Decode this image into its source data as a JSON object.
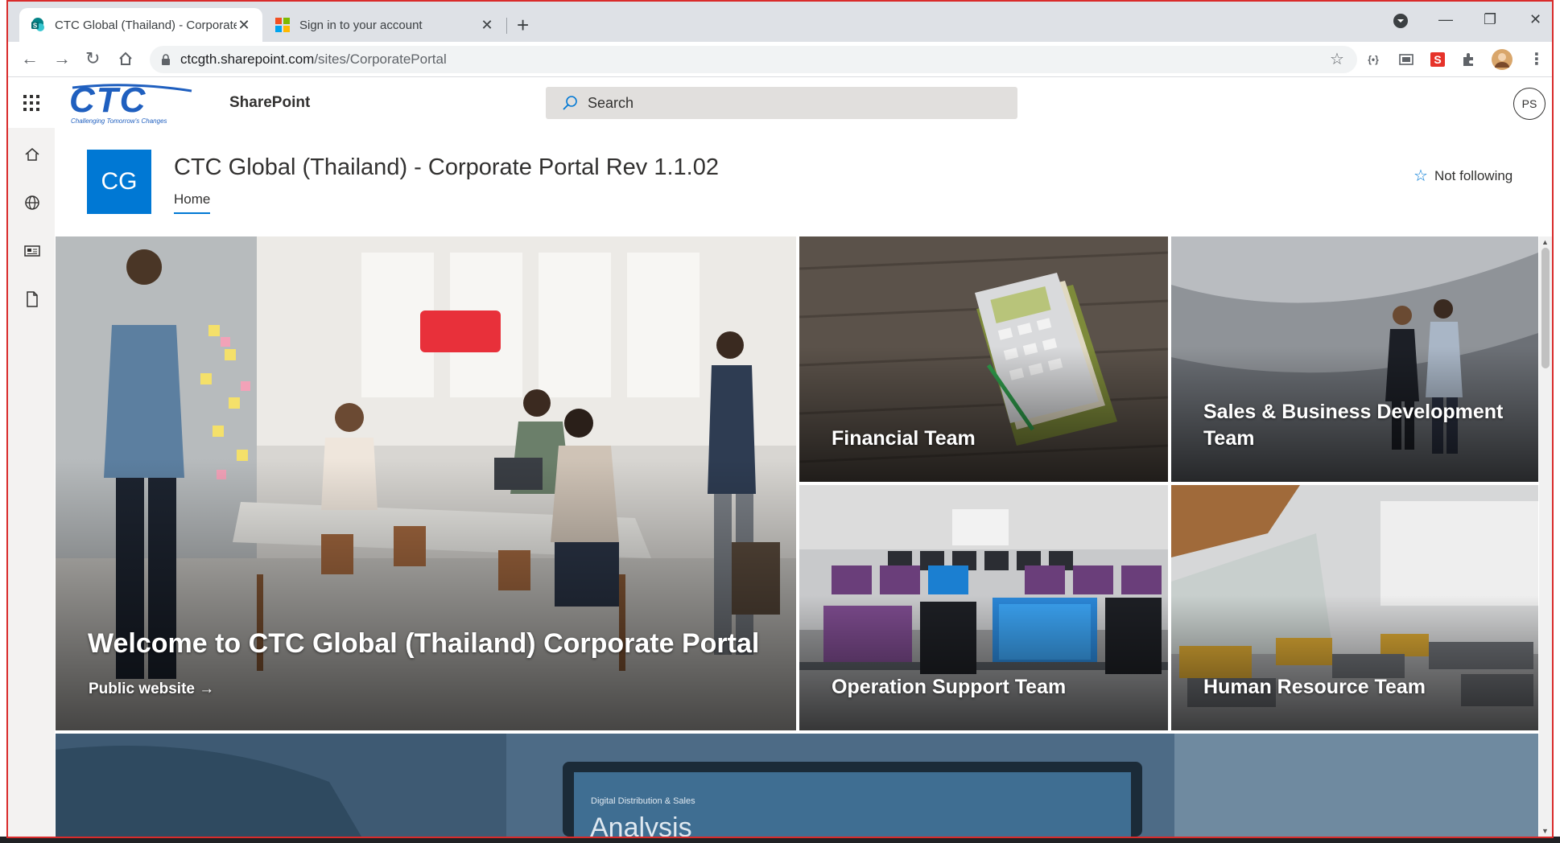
{
  "browser": {
    "tabs": [
      {
        "title": "CTC Global (Thailand) - Corporate Portal",
        "active": true
      },
      {
        "title": "Sign in to your account",
        "active": false
      }
    ],
    "new_tab": "+",
    "close": "✕",
    "address": {
      "host": "ctcgth.sharepoint.com",
      "path": "/sites/CorporatePortal"
    },
    "window_controls": {
      "minimize": "—",
      "restore": "❐",
      "close": "✕"
    }
  },
  "suite": {
    "logo_text": "CTC",
    "logo_tagline": "Challenging Tomorrow's Changes",
    "app_name": "SharePoint",
    "search_placeholder": "Search",
    "user_initials": "PS"
  },
  "site": {
    "initials": "CG",
    "title": "CTC Global (Thailand) - Corporate Portal Rev 1.1.02",
    "nav": [
      "Home"
    ],
    "follow_label": "Not following"
  },
  "hero": {
    "main": {
      "title": "Welcome to CTC Global (Thailand) Corporate Portal",
      "link": "Public website"
    },
    "tiles": [
      {
        "title": "Financial Team"
      },
      {
        "title": "Sales & Business Development Team"
      },
      {
        "title": "Operation Support Team"
      },
      {
        "title": "Human Resource Team"
      }
    ]
  },
  "below_banner": {
    "label": "Digital Distribution & Sales",
    "heading": "Analysis"
  },
  "colors": {
    "accent": "#0078d4",
    "frame": "#d92b2b"
  }
}
